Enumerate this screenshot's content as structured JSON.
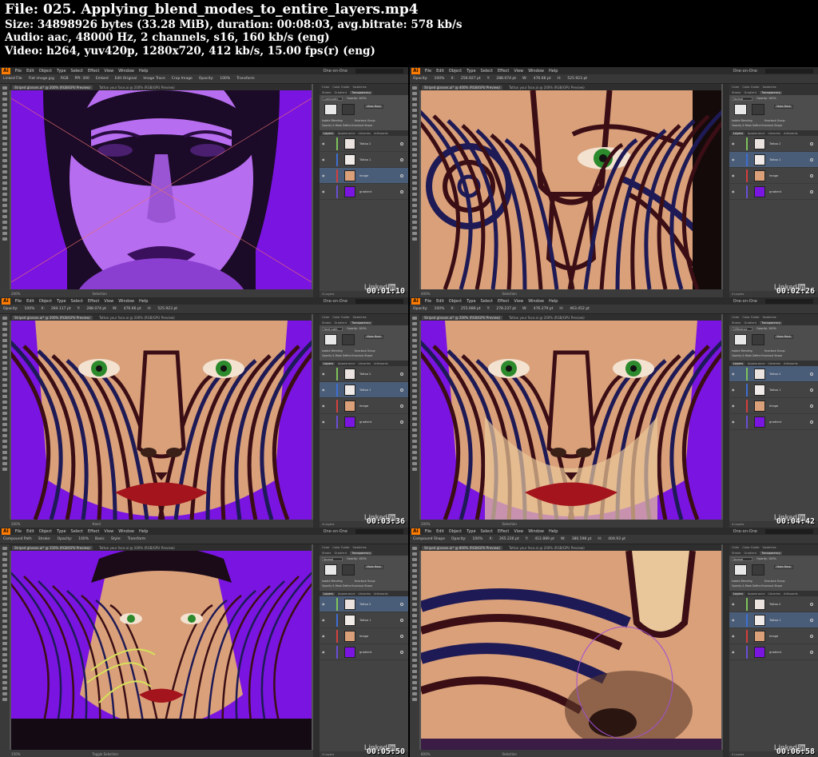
{
  "header": {
    "file_line": "File: 025. Applying_blend_modes_to_entire_layers.mp4",
    "size_line": "Size: 34898926 bytes (33.28 MiB), duration: 00:08:03, avg.bitrate: 578 kb/s",
    "audio_line": "Audio: aac, 48000 Hz, 2 channels, s16, 160 kb/s (eng)",
    "video_line": "Video: h264, yuv420p, 1280x720, 412 kb/s, 15.00 fps(r) (eng)"
  },
  "colors": {
    "ai_orange": "#ff7c00",
    "purple_bg": "#7a14e0",
    "tattoo_dark": "#3a0e14",
    "tattoo_navy": "#1e1a55",
    "skin": "#d9a07a",
    "selection_blue": "#4a5d78"
  },
  "app": {
    "logo": "Ai",
    "menus": [
      "File",
      "Edit",
      "Object",
      "Type",
      "Select",
      "Effect",
      "View",
      "Window",
      "Help"
    ],
    "workspace": "One-on-One",
    "panel_tabs": [
      "Color",
      "Color Guide",
      "Swatches",
      "Stroke",
      "Gradient",
      "Transparency"
    ],
    "layer_tabs": [
      "Layers",
      "Appearance",
      "Libraries",
      "Artboards"
    ],
    "make_mask": "Make Mask",
    "clip": "Clip",
    "invert_mask": "Invert Mask",
    "isolate_blending": "Isolate Blending",
    "knockout_group": "Knockout Group",
    "opacity_mask_label": "Opacity & Mask Define Knockout Shape",
    "layers_count": "4 Layers"
  },
  "layers": [
    "Tattoo 2",
    "Tattoo 1",
    "Image",
    "gradient"
  ],
  "tiles": [
    {
      "doc_tabs": [
        "Striped glasses.ai* @ 200% (RGB/GPU Preview)",
        "Tattoo your face.ai @ 200% (RGB/GPU Preview)"
      ],
      "control": [
        "Linked File",
        "Flat image.jpg",
        "RGB",
        "PPI: 300",
        "Embed",
        "Edit Original",
        "Image Trace",
        "Crop Image",
        "Opacity:",
        "100%",
        "Transform"
      ],
      "blend_mode": "Luminosity",
      "opacity": "100%",
      "zoom": "200%",
      "tool": "Selection",
      "selected_layer": 2,
      "timestamp": "00:01:10"
    },
    {
      "doc_tabs": [
        "Striped glasses.ai* @ 400% (RGB/GPU Preview)",
        "Tattoo your face.ai @ 200% (RGB/GPU Preview)"
      ],
      "control": [
        "Opacity:",
        "100%",
        "X:",
        "256.927 pt",
        "Y:",
        "288.074 pt",
        "W:",
        "476.66 pt",
        "H:",
        "525.923 pt"
      ],
      "blend_mode": "Normal",
      "opacity": "100%",
      "zoom": "400%",
      "tool": "Selection",
      "selected_layer": 1,
      "timestamp": "00:02:26"
    },
    {
      "doc_tabs": [
        "Striped glasses.ai* @ 200% (RGB/GPU Preview)",
        "Tattoo your face.ai @ 200% (RGB/GPU Preview)"
      ],
      "control": [
        "Opacity:",
        "100%",
        "X:",
        "284.117 pt",
        "Y:",
        "288.074 pt",
        "W:",
        "476.66 pt",
        "H:",
        "525.923 pt"
      ],
      "blend_mode": "Hard Light",
      "opacity": "100%",
      "zoom": "200%",
      "tool": "Hand",
      "selected_layer": 1,
      "timestamp": "00:03:36"
    },
    {
      "doc_tabs": [
        "Striped glasses.ai* @ 200% (RGB/GPU Preview)",
        "Tattoo your face.ai @ 200% (RGB/GPU Preview)"
      ],
      "control": [
        "Opacity:",
        "100%",
        "X:",
        "255.686 pt",
        "Y:",
        "278.237 pt",
        "W:",
        "476.279 pt",
        "H:",
        "463.452 pt"
      ],
      "blend_mode": "Difference",
      "opacity": "100%",
      "zoom": "200%",
      "tool": "Selection",
      "selected_layer": 0,
      "timestamp": "00:04:42"
    },
    {
      "doc_tabs": [
        "Striped glasses.ai* @ 150% (RGB/GPU Preview)",
        "Tattoo your face.ai @ 200% (RGB/GPU Preview)"
      ],
      "control": [
        "Compound Path",
        "Stroke:",
        "Opacity:",
        "100%",
        "Basic",
        "Style:",
        "Transform"
      ],
      "blend_mode": "Normal",
      "opacity": "100%",
      "zoom": "150%",
      "tool": "Toggle Selection",
      "selected_layer": 0,
      "timestamp": "00:05:50"
    },
    {
      "doc_tabs": [
        "Striped glasses.ai* @ 800% (RGB/GPU Preview)",
        "Tattoo your face.ai @ 200% (RGB/GPU Preview)"
      ],
      "control": [
        "Compound Shape",
        "Opacity:",
        "100%",
        "X:",
        "265.226 pt",
        "Y:",
        "412.889 pt",
        "W:",
        "386.598 pt",
        "H:",
        "404.93 pt"
      ],
      "blend_mode": "Normal",
      "opacity": "100%",
      "zoom": "800%",
      "tool": "Selection",
      "selected_layer": 1,
      "timestamp": "00:06:58"
    }
  ],
  "watermark": {
    "text": "Linked",
    "suffix": "in"
  }
}
